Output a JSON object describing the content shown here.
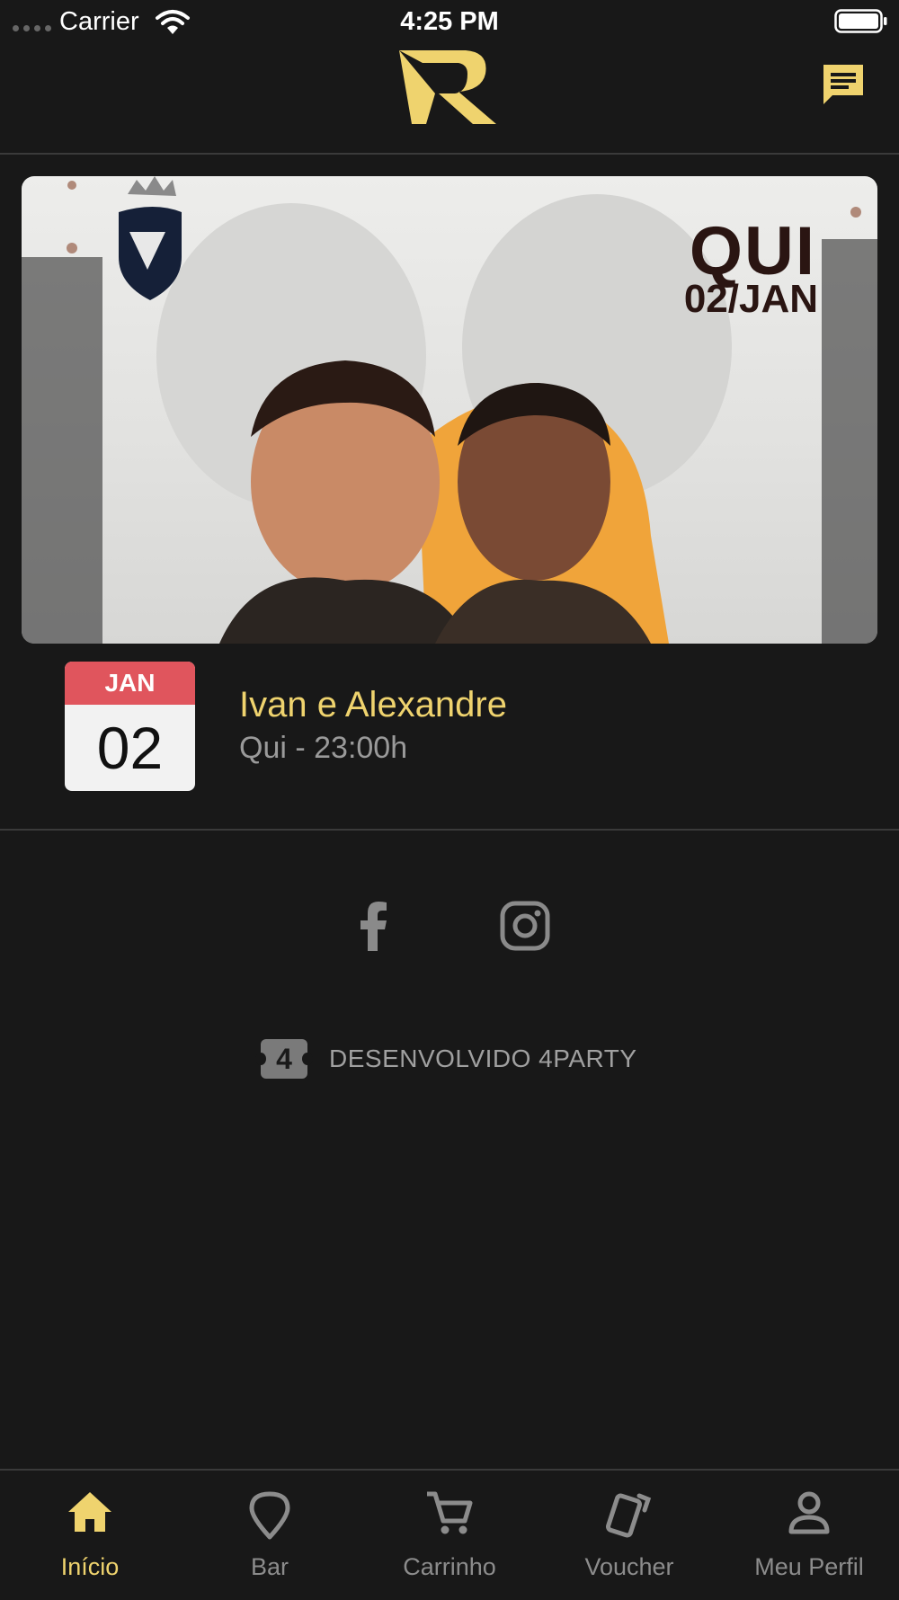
{
  "status_bar": {
    "carrier": "Carrier",
    "time": "4:25 PM"
  },
  "header": {
    "logo_icon": "venue-logo-icon",
    "chat_icon": "chat-icon"
  },
  "colors": {
    "accent": "#efd36e",
    "background": "#181818",
    "calendar_header": "#e0555d",
    "muted": "#9a9a9a"
  },
  "event": {
    "banner": {
      "day": "QUI",
      "date": "02/JAN"
    },
    "month": "JAN",
    "day": "02",
    "title": "Ivan e Alexandre",
    "time": "Qui - 23:00h"
  },
  "social": {
    "facebook_icon": "facebook-icon",
    "instagram_icon": "instagram-icon"
  },
  "credit": {
    "badge": "4",
    "text": "DESENVOLVIDO 4PARTY"
  },
  "tabs": [
    {
      "label": "Início",
      "icon": "home-icon",
      "active": true
    },
    {
      "label": "Bar",
      "icon": "location-pin-icon",
      "active": false
    },
    {
      "label": "Carrinho",
      "icon": "cart-icon",
      "active": false
    },
    {
      "label": "Voucher",
      "icon": "voucher-cards-icon",
      "active": false
    },
    {
      "label": "Meu Perfil",
      "icon": "profile-icon",
      "active": false
    }
  ]
}
